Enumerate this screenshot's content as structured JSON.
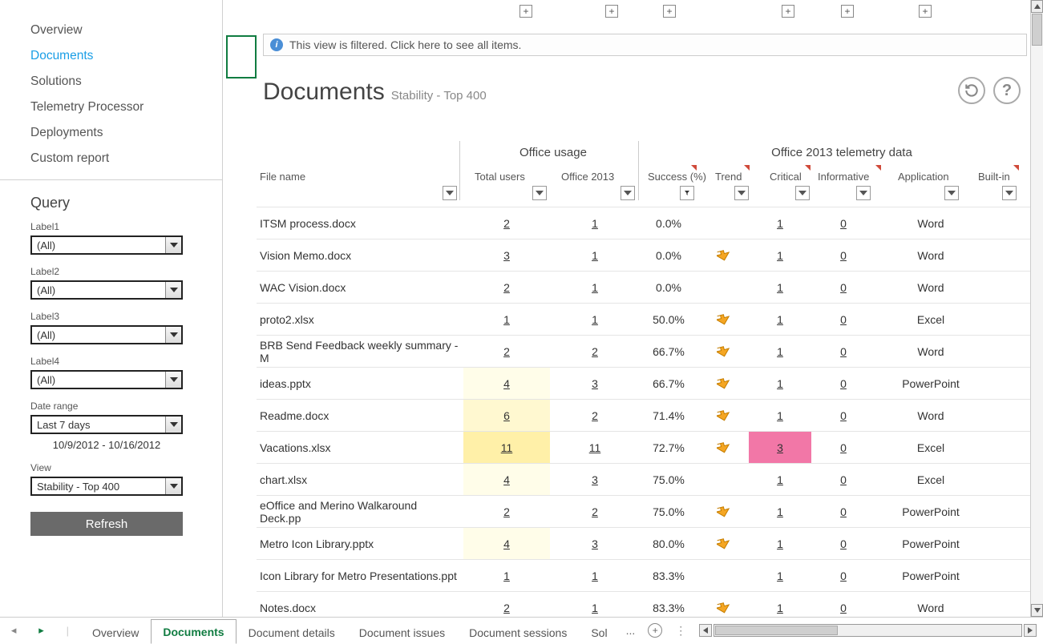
{
  "nav": {
    "items": [
      {
        "label": "Overview",
        "active": false
      },
      {
        "label": "Documents",
        "active": true
      },
      {
        "label": "Solutions",
        "active": false
      },
      {
        "label": "Telemetry Processor",
        "active": false
      },
      {
        "label": "Deployments",
        "active": false
      },
      {
        "label": "Custom report",
        "active": false
      }
    ]
  },
  "query": {
    "heading": "Query",
    "label1": {
      "label": "Label1",
      "value": "(All)"
    },
    "label2": {
      "label": "Label2",
      "value": "(All)"
    },
    "label3": {
      "label": "Label3",
      "value": "(All)"
    },
    "label4": {
      "label": "Label4",
      "value": "(All)"
    },
    "daterange": {
      "label": "Date range",
      "value": "Last 7 days",
      "text": "10/9/2012 - 10/16/2012"
    },
    "view": {
      "label": "View",
      "value": "Stability - Top 400"
    },
    "refresh": "Refresh"
  },
  "banner": "This view is filtered. Click here to see all items.",
  "page": {
    "title": "Documents",
    "subtitle": "Stability - Top 400"
  },
  "groups": {
    "usage": "Office usage",
    "telemetry": "Office 2013 telemetry data"
  },
  "columns": {
    "filename": "File name",
    "totalusers": "Total users",
    "office2013": "Office 2013",
    "success": "Success (%)",
    "trend": "Trend",
    "critical": "Critical",
    "informative": "Informative",
    "application": "Application",
    "builtin": "Built-in"
  },
  "rows": [
    {
      "file": "ITSM process.docx",
      "tu": "2",
      "o13": "1",
      "succ": "0.0%",
      "trend": false,
      "crit": "1",
      "info": "0",
      "app": "Word",
      "tu_heat": "",
      "crit_hl": false
    },
    {
      "file": "Vision Memo.docx",
      "tu": "3",
      "o13": "1",
      "succ": "0.0%",
      "trend": true,
      "crit": "1",
      "info": "0",
      "app": "Word",
      "tu_heat": "",
      "crit_hl": false
    },
    {
      "file": "WAC Vision.docx",
      "tu": "2",
      "o13": "1",
      "succ": "0.0%",
      "trend": false,
      "crit": "1",
      "info": "0",
      "app": "Word",
      "tu_heat": "",
      "crit_hl": false
    },
    {
      "file": "proto2.xlsx",
      "tu": "1",
      "o13": "1",
      "succ": "50.0%",
      "trend": true,
      "crit": "1",
      "info": "0",
      "app": "Excel",
      "tu_heat": "",
      "crit_hl": false
    },
    {
      "file": "BRB Send Feedback weekly summary - M",
      "tu": "2",
      "o13": "2",
      "succ": "66.7%",
      "trend": true,
      "crit": "1",
      "info": "0",
      "app": "Word",
      "tu_heat": "",
      "crit_hl": false
    },
    {
      "file": "ideas.pptx",
      "tu": "4",
      "o13": "3",
      "succ": "66.7%",
      "trend": true,
      "crit": "1",
      "info": "0",
      "app": "PowerPoint",
      "tu_heat": "heat-yel1",
      "crit_hl": false
    },
    {
      "file": "Readme.docx",
      "tu": "6",
      "o13": "2",
      "succ": "71.4%",
      "trend": true,
      "crit": "1",
      "info": "0",
      "app": "Word",
      "tu_heat": "heat-yel2",
      "crit_hl": false
    },
    {
      "file": "Vacations.xlsx",
      "tu": "11",
      "o13": "11",
      "succ": "72.7%",
      "trend": true,
      "crit": "3",
      "info": "0",
      "app": "Excel",
      "tu_heat": "heat-yel3",
      "crit_hl": true
    },
    {
      "file": "chart.xlsx",
      "tu": "4",
      "o13": "3",
      "succ": "75.0%",
      "trend": false,
      "crit": "1",
      "info": "0",
      "app": "Excel",
      "tu_heat": "heat-yel1",
      "crit_hl": false
    },
    {
      "file": "eOffice and Merino Walkaround Deck.pp",
      "tu": "2",
      "o13": "2",
      "succ": "75.0%",
      "trend": true,
      "crit": "1",
      "info": "0",
      "app": "PowerPoint",
      "tu_heat": "",
      "crit_hl": false
    },
    {
      "file": "Metro Icon Library.pptx",
      "tu": "4",
      "o13": "3",
      "succ": "80.0%",
      "trend": true,
      "crit": "1",
      "info": "0",
      "app": "PowerPoint",
      "tu_heat": "heat-yel1",
      "crit_hl": false
    },
    {
      "file": "Icon Library for Metro Presentations.ppt",
      "tu": "1",
      "o13": "1",
      "succ": "83.3%",
      "trend": false,
      "crit": "1",
      "info": "0",
      "app": "PowerPoint",
      "tu_heat": "",
      "crit_hl": false
    },
    {
      "file": "Notes.docx",
      "tu": "2",
      "o13": "1",
      "succ": "83.3%",
      "trend": true,
      "crit": "1",
      "info": "0",
      "app": "Word",
      "tu_heat": "",
      "crit_hl": false
    }
  ],
  "sheets": {
    "tabs": [
      "Overview",
      "Documents",
      "Document details",
      "Document issues",
      "Document sessions",
      "Sol"
    ],
    "active": "Documents",
    "overflow": "..."
  }
}
